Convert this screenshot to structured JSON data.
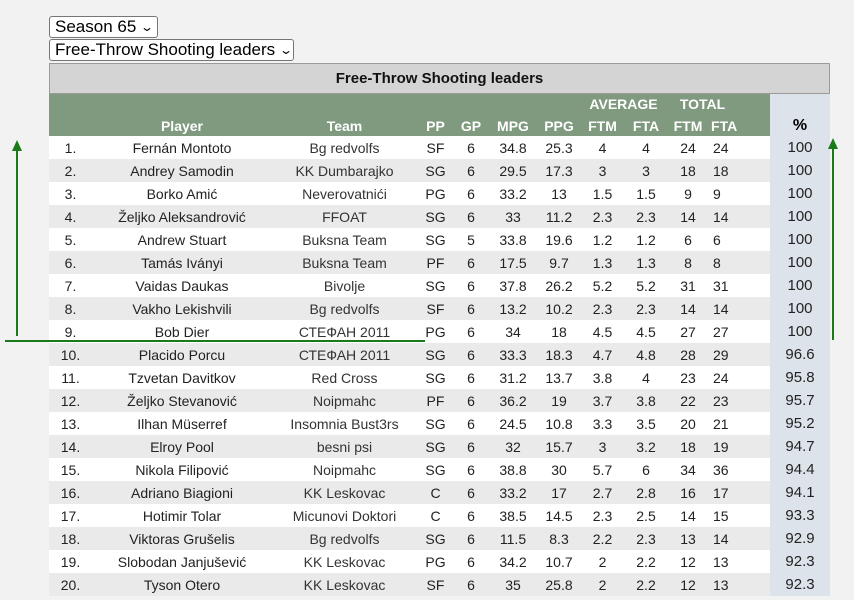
{
  "season_select": {
    "value": "Season 65"
  },
  "category_select": {
    "value": "Free-Throw Shooting leaders"
  },
  "table_title": "Free-Throw Shooting leaders",
  "headers": {
    "group_average": "AVERAGE",
    "group_total": "TOTAL",
    "player": "Player",
    "team": "Team",
    "pp": "PP",
    "gp": "GP",
    "mpg": "MPG",
    "ppg": "PPG",
    "avg_ftm": "FTM",
    "avg_fta": "FTA",
    "tot_ftm": "FTM",
    "tot_fta": "FTA",
    "pct": "%"
  },
  "rows": [
    {
      "rank": "1.",
      "player": "Fernán Montoto",
      "team": "Bg redvolfs",
      "pp": "SF",
      "gp": "6",
      "mpg": "34.8",
      "ppg": "25.3",
      "avg_ftm": "4",
      "avg_fta": "4",
      "tot_ftm": "24",
      "tot_fta": "24",
      "pct": "100"
    },
    {
      "rank": "2.",
      "player": "Andrey Samodin",
      "team": "KK Dumbarajko",
      "pp": "SG",
      "gp": "6",
      "mpg": "29.5",
      "ppg": "17.3",
      "avg_ftm": "3",
      "avg_fta": "3",
      "tot_ftm": "18",
      "tot_fta": "18",
      "pct": "100"
    },
    {
      "rank": "3.",
      "player": "Borko Amić",
      "team": "Neverovatnići",
      "pp": "PG",
      "gp": "6",
      "mpg": "33.2",
      "ppg": "13",
      "avg_ftm": "1.5",
      "avg_fta": "1.5",
      "tot_ftm": "9",
      "tot_fta": "9",
      "pct": "100"
    },
    {
      "rank": "4.",
      "player": "Željko Aleksandrović",
      "team": "FFOAT",
      "pp": "SG",
      "gp": "6",
      "mpg": "33",
      "ppg": "11.2",
      "avg_ftm": "2.3",
      "avg_fta": "2.3",
      "tot_ftm": "14",
      "tot_fta": "14",
      "pct": "100"
    },
    {
      "rank": "5.",
      "player": "Andrew Stuart",
      "team": "Buksna Team",
      "pp": "SG",
      "gp": "5",
      "mpg": "33.8",
      "ppg": "19.6",
      "avg_ftm": "1.2",
      "avg_fta": "1.2",
      "tot_ftm": "6",
      "tot_fta": "6",
      "pct": "100"
    },
    {
      "rank": "6.",
      "player": "Tamás Iványi",
      "team": "Buksna Team",
      "pp": "PF",
      "gp": "6",
      "mpg": "17.5",
      "ppg": "9.7",
      "avg_ftm": "1.3",
      "avg_fta": "1.3",
      "tot_ftm": "8",
      "tot_fta": "8",
      "pct": "100"
    },
    {
      "rank": "7.",
      "player": "Vaidas Daukas",
      "team": "Bivolje",
      "pp": "SG",
      "gp": "6",
      "mpg": "37.8",
      "ppg": "26.2",
      "avg_ftm": "5.2",
      "avg_fta": "5.2",
      "tot_ftm": "31",
      "tot_fta": "31",
      "pct": "100"
    },
    {
      "rank": "8.",
      "player": "Vakho Lekishvili",
      "team": "Bg redvolfs",
      "pp": "SF",
      "gp": "6",
      "mpg": "13.2",
      "ppg": "10.2",
      "avg_ftm": "2.3",
      "avg_fta": "2.3",
      "tot_ftm": "14",
      "tot_fta": "14",
      "pct": "100"
    },
    {
      "rank": "9.",
      "player": "Bob Dier",
      "team": "СТЕФАН 2011",
      "pp": "PG",
      "gp": "6",
      "mpg": "34",
      "ppg": "18",
      "avg_ftm": "4.5",
      "avg_fta": "4.5",
      "tot_ftm": "27",
      "tot_fta": "27",
      "pct": "100"
    },
    {
      "rank": "10.",
      "player": "Placido Porcu",
      "team": "СТЕФАН 2011",
      "pp": "SG",
      "gp": "6",
      "mpg": "33.3",
      "ppg": "18.3",
      "avg_ftm": "4.7",
      "avg_fta": "4.8",
      "tot_ftm": "28",
      "tot_fta": "29",
      "pct": "96.6"
    },
    {
      "rank": "11.",
      "player": "Tzvetan Davitkov",
      "team": "Red Cross",
      "pp": "SG",
      "gp": "6",
      "mpg": "31.2",
      "ppg": "13.7",
      "avg_ftm": "3.8",
      "avg_fta": "4",
      "tot_ftm": "23",
      "tot_fta": "24",
      "pct": "95.8"
    },
    {
      "rank": "12.",
      "player": "Željko Stevanović",
      "team": "Noipmahc",
      "pp": "PF",
      "gp": "6",
      "mpg": "36.2",
      "ppg": "19",
      "avg_ftm": "3.7",
      "avg_fta": "3.8",
      "tot_ftm": "22",
      "tot_fta": "23",
      "pct": "95.7"
    },
    {
      "rank": "13.",
      "player": "Ilhan Müserref",
      "team": "Insomnia Bust3rs",
      "pp": "SG",
      "gp": "6",
      "mpg": "24.5",
      "ppg": "10.8",
      "avg_ftm": "3.3",
      "avg_fta": "3.5",
      "tot_ftm": "20",
      "tot_fta": "21",
      "pct": "95.2"
    },
    {
      "rank": "14.",
      "player": "Elroy Pool",
      "team": "besni psi",
      "pp": "SG",
      "gp": "6",
      "mpg": "32",
      "ppg": "15.7",
      "avg_ftm": "3",
      "avg_fta": "3.2",
      "tot_ftm": "18",
      "tot_fta": "19",
      "pct": "94.7"
    },
    {
      "rank": "15.",
      "player": "Nikola Filipović",
      "team": "Noipmahc",
      "pp": "SG",
      "gp": "6",
      "mpg": "38.8",
      "ppg": "30",
      "avg_ftm": "5.7",
      "avg_fta": "6",
      "tot_ftm": "34",
      "tot_fta": "36",
      "pct": "94.4"
    },
    {
      "rank": "16.",
      "player": "Adriano Biagioni",
      "team": "KK Leskovac",
      "pp": "C",
      "gp": "6",
      "mpg": "33.2",
      "ppg": "17",
      "avg_ftm": "2.7",
      "avg_fta": "2.8",
      "tot_ftm": "16",
      "tot_fta": "17",
      "pct": "94.1"
    },
    {
      "rank": "17.",
      "player": "Hotimir Tolar",
      "team": "Micunovi Doktori",
      "pp": "C",
      "gp": "6",
      "mpg": "38.5",
      "ppg": "14.5",
      "avg_ftm": "2.3",
      "avg_fta": "2.5",
      "tot_ftm": "14",
      "tot_fta": "15",
      "pct": "93.3"
    },
    {
      "rank": "18.",
      "player": "Viktoras Grušelis",
      "team": "Bg redvolfs",
      "pp": "SG",
      "gp": "6",
      "mpg": "11.5",
      "ppg": "8.3",
      "avg_ftm": "2.2",
      "avg_fta": "2.3",
      "tot_ftm": "13",
      "tot_fta": "14",
      "pct": "92.9"
    },
    {
      "rank": "19.",
      "player": "Slobodan Janjušević",
      "team": "KK Leskovac",
      "pp": "PG",
      "gp": "6",
      "mpg": "34.2",
      "ppg": "10.7",
      "avg_ftm": "2",
      "avg_fta": "2.2",
      "tot_ftm": "12",
      "tot_fta": "13",
      "pct": "92.3"
    },
    {
      "rank": "20.",
      "player": "Tyson Otero",
      "team": "KK Leskovac",
      "pp": "SF",
      "gp": "6",
      "mpg": "35",
      "ppg": "25.8",
      "avg_ftm": "2",
      "avg_fta": "2.2",
      "tot_ftm": "12",
      "tot_fta": "13",
      "pct": "92.3"
    }
  ],
  "annotations": {
    "color": "#1a7a1a"
  }
}
